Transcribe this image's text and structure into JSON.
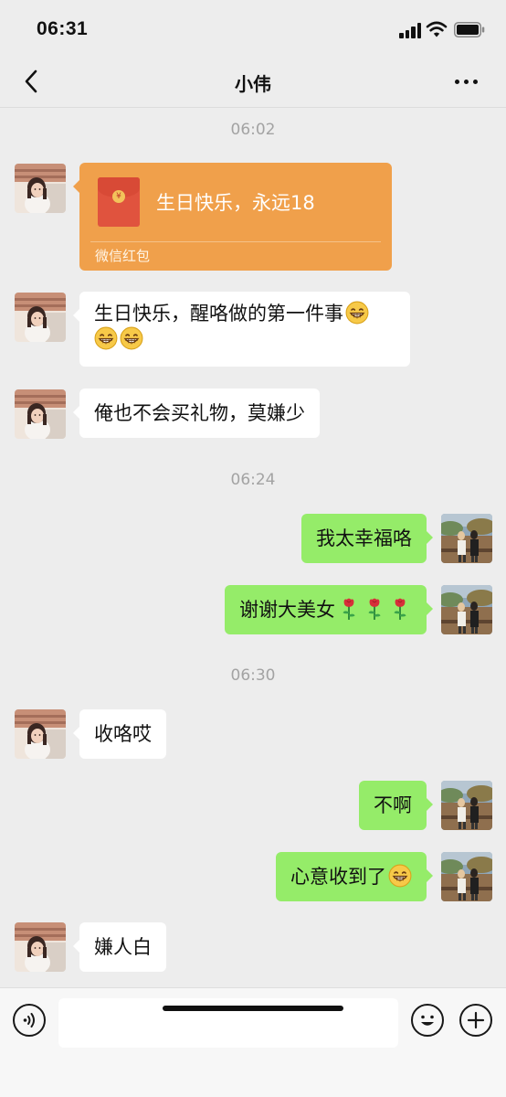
{
  "status": {
    "time": "06:31"
  },
  "header": {
    "title": "小伟"
  },
  "timestamps": [
    "06:02",
    "06:24",
    "06:30"
  ],
  "red_packet": {
    "text": "生日快乐，永远18",
    "footer": "微信红包",
    "color": "#f0a04b"
  },
  "messages": [
    {
      "from": "them",
      "text": "生日快乐，醒咯做的第一件事",
      "emoji": "grin-emoji",
      "line2_emoji_count": 2
    },
    {
      "from": "them",
      "text": "俺也不会买礼物，莫嫌少"
    },
    {
      "from": "me",
      "text": "我太幸福咯"
    },
    {
      "from": "me",
      "text": "谢谢大美女",
      "emoji": "rose-emoji",
      "emoji_count": 3
    },
    {
      "from": "them",
      "text": "收咯哎"
    },
    {
      "from": "me",
      "text": "不啊"
    },
    {
      "from": "me",
      "text": "心意收到了",
      "emoji": "grin-emoji",
      "emoji_count": 1
    },
    {
      "from": "them",
      "text": "嫌人白"
    }
  ],
  "input": {
    "value": ""
  },
  "colors": {
    "background": "#ededed",
    "incoming_bubble": "#ffffff",
    "outgoing_bubble": "#95ec69"
  }
}
